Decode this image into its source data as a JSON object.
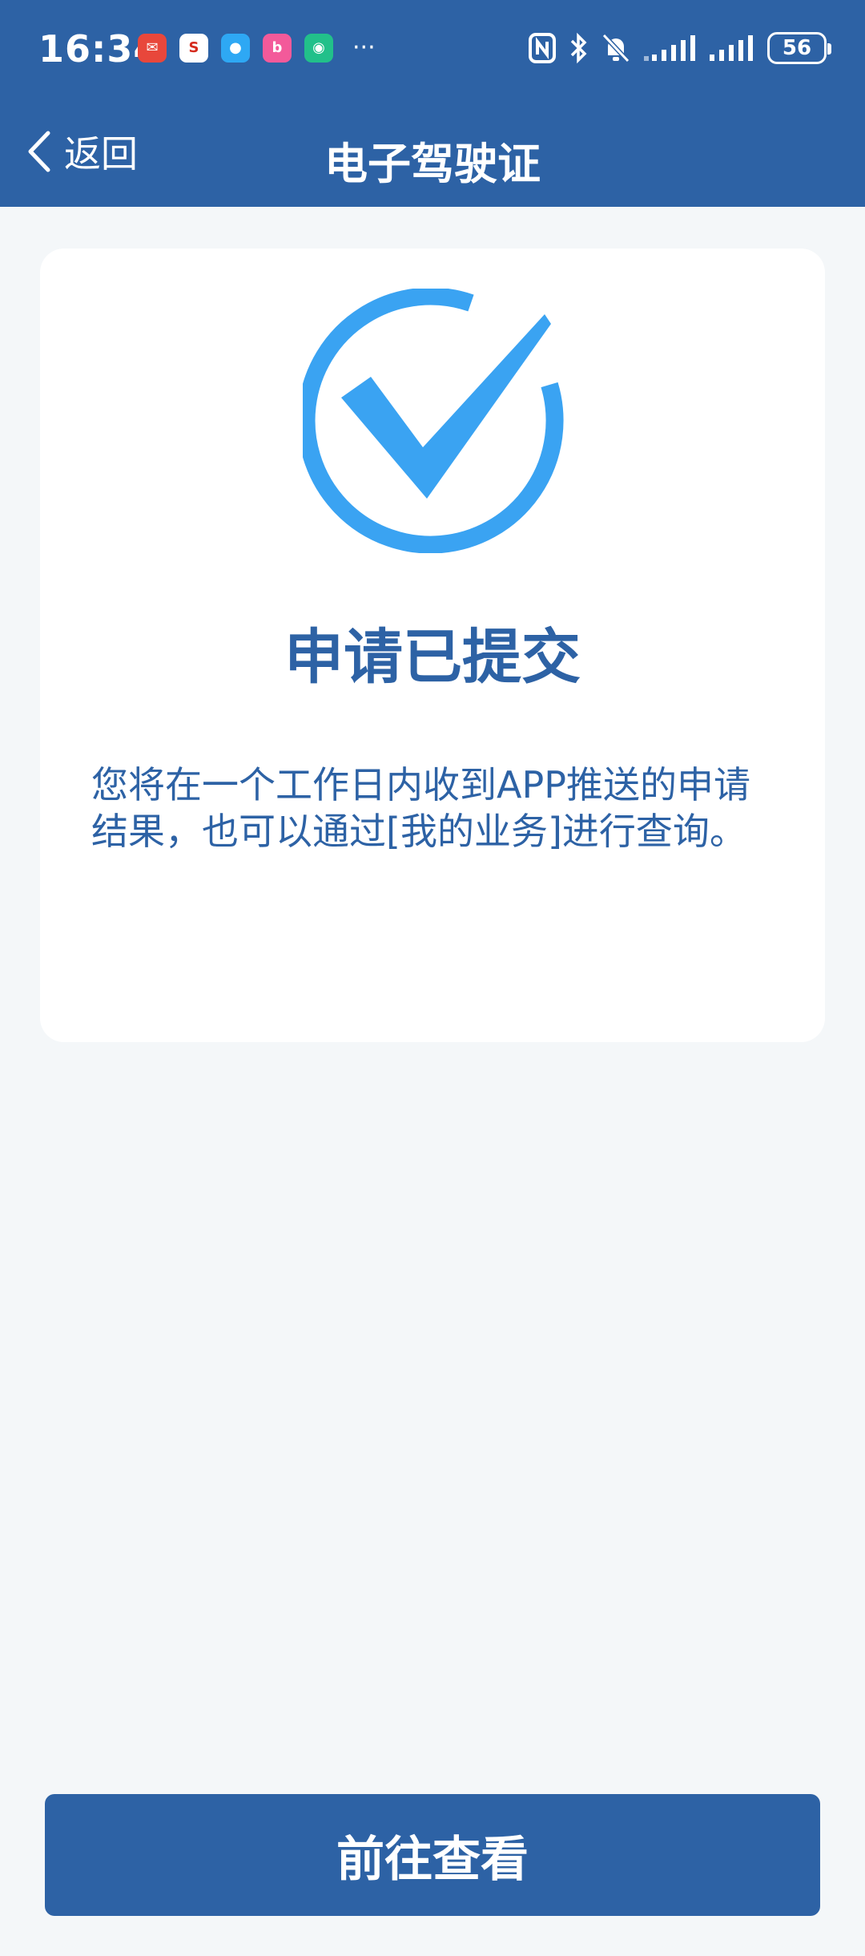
{
  "status_bar": {
    "time": "16:34",
    "battery": "56",
    "more": "···",
    "app_icons": [
      {
        "name": "app-icon-red",
        "color": "#E8473B",
        "glyph": "✉"
      },
      {
        "name": "app-icon-sina",
        "color": "#FFFFFF",
        "glyph": "S"
      },
      {
        "name": "app-icon-chat",
        "color": "#2EA8F4",
        "glyph": "●"
      },
      {
        "name": "app-icon-pink",
        "color": "#F35A9A",
        "glyph": "b"
      },
      {
        "name": "app-icon-green",
        "color": "#22C08A",
        "glyph": "◉"
      }
    ]
  },
  "nav": {
    "back_label": "返回",
    "title": "电子驾驶证"
  },
  "result": {
    "title": "申请已提交",
    "description": "您将在一个工作日内收到APP推送的申请结果，也可以通过[我的业务]进行查询。"
  },
  "actions": {
    "view_label": "前往查看"
  },
  "colors": {
    "primary": "#2D62A5",
    "check": "#3AA3F2",
    "background": "#F4F7F9"
  }
}
